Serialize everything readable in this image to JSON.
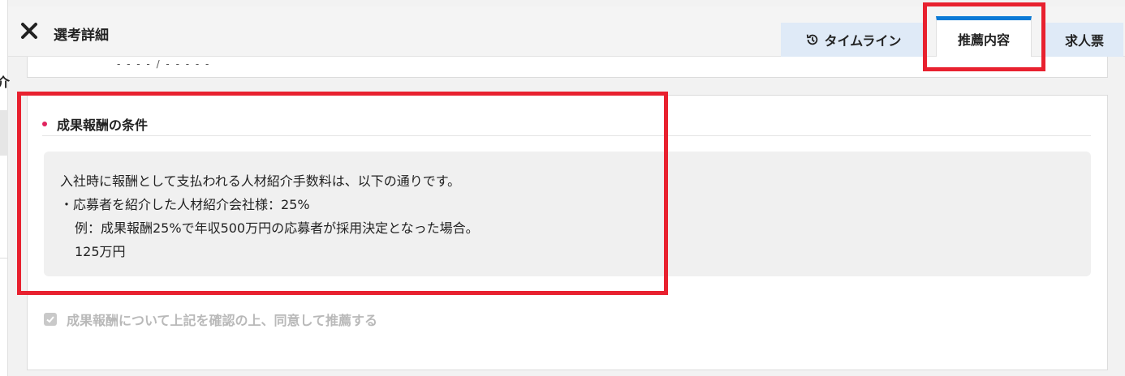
{
  "header": {
    "title": "選考詳細",
    "tabs": [
      {
        "label": "タイムライン",
        "icon": "history-icon"
      },
      {
        "label": "推薦内容"
      },
      {
        "label": "求人票"
      }
    ]
  },
  "left_fragment": "介",
  "upper_card": {
    "text": "- - - - / - - - - -"
  },
  "section": {
    "title": "成果報酬の条件",
    "lines": [
      "入社時に報酬として支払われる人材紹介手数料は、以下の通りです。",
      "・応募者を紹介した人材紹介会社様：25%",
      "例：成果報酬25%で年収500万円の応募者が採用決定となった場合。",
      "125万円"
    ]
  },
  "agreement": {
    "label": "成果報酬について上記を確認の上、同意して推薦する",
    "checked": true
  },
  "colors": {
    "accent": "#0a7ad6",
    "tab_bg": "#dfeaf7",
    "bullet": "#e0245e",
    "highlight": "#e8212f"
  }
}
